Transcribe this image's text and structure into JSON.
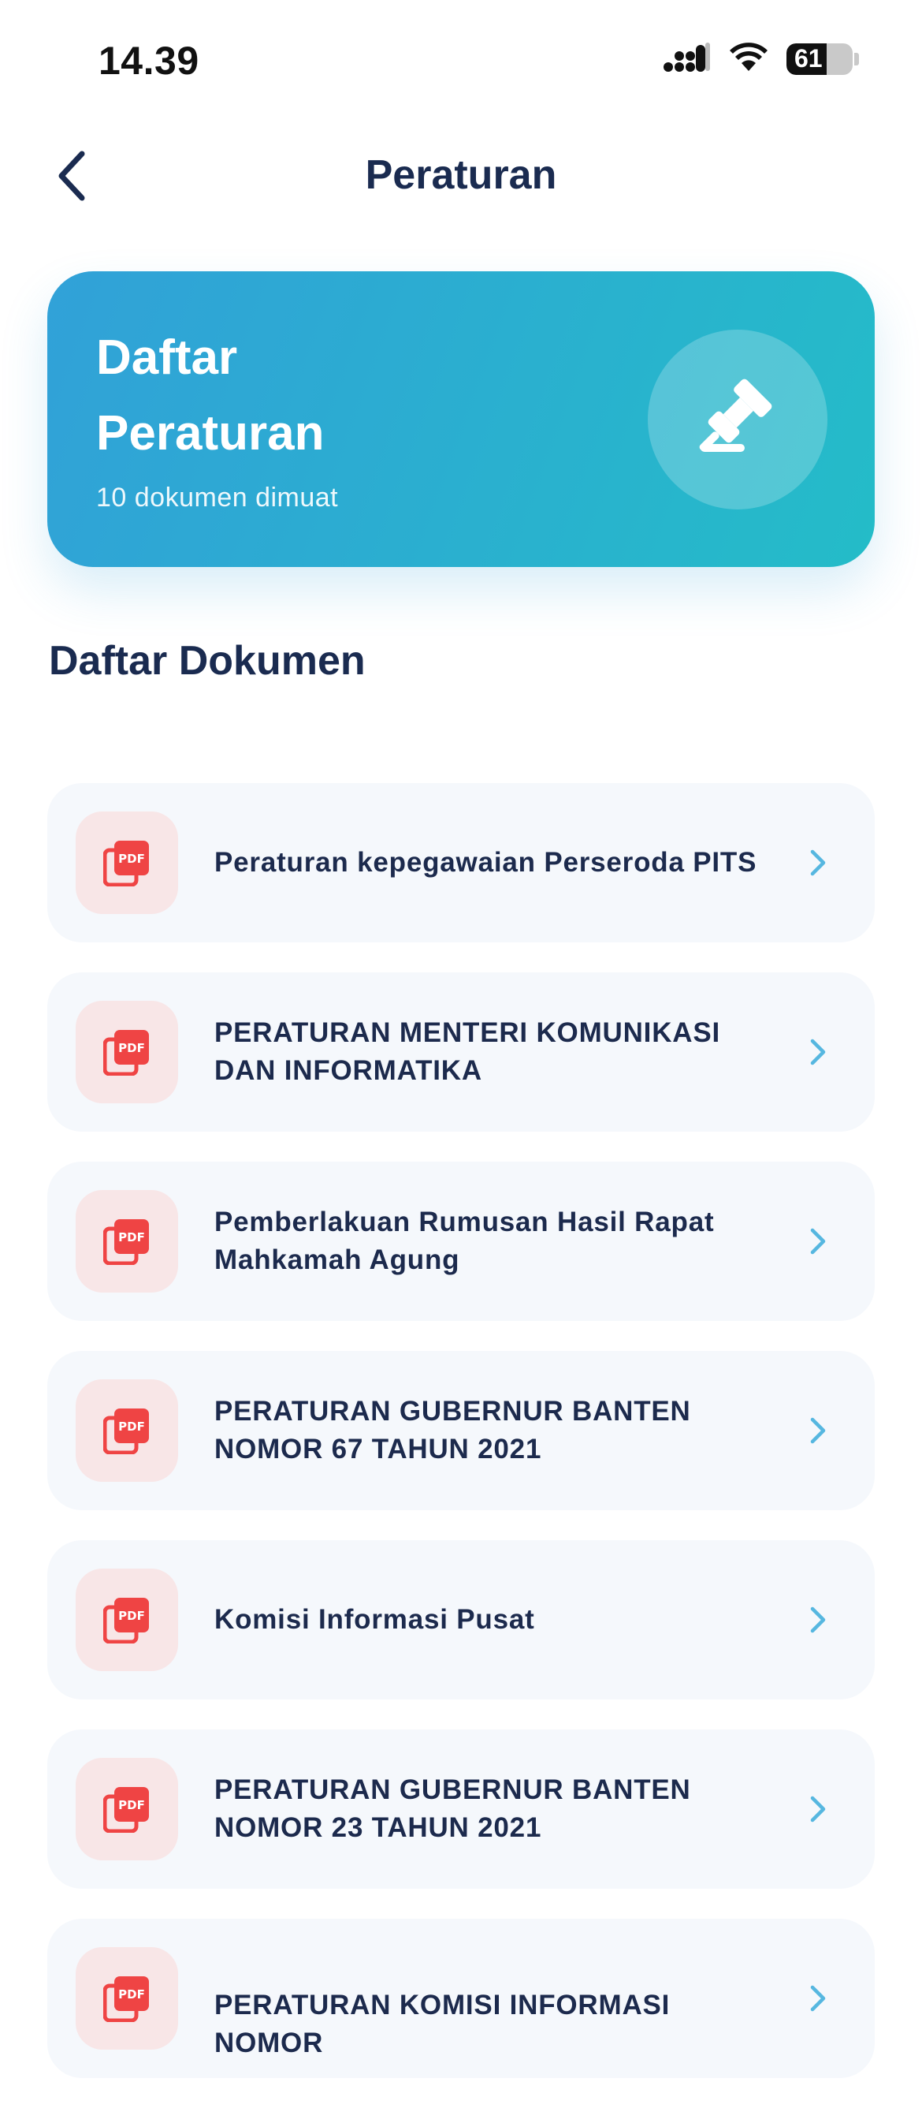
{
  "status_bar": {
    "time": "14.39",
    "battery_level": "61"
  },
  "header": {
    "title": "Peraturan"
  },
  "hero": {
    "title_line1": "Daftar",
    "title_line2": "Peraturan",
    "subtitle": "10 dokumen dimuat",
    "icon": "gavel-icon"
  },
  "section": {
    "title": "Daftar Dokumen"
  },
  "documents": [
    {
      "label": "Peraturan kepegawaian Perseroda PITS"
    },
    {
      "label": "PERATURAN MENTERI KOMUNIKASI DAN INFORMATIKA"
    },
    {
      "label": "Pemberlakuan Rumusan Hasil Rapat Mahkamah Agung"
    },
    {
      "label": "PERATURAN GUBERNUR BANTEN NOMOR 67 TAHUN 2021"
    },
    {
      "label": "Komisi Informasi Pusat"
    },
    {
      "label": "PERATURAN GUBERNUR BANTEN NOMOR 23 TAHUN 2021"
    },
    {
      "label": "PERATURAN KOMISI INFORMASI NOMOR"
    }
  ],
  "colors": {
    "accent_start": "#31a1d8",
    "accent_end": "#24bcc8",
    "pdf_red": "#ef4444",
    "chevron": "#56b7e0",
    "title_navy": "#1a2b50"
  }
}
